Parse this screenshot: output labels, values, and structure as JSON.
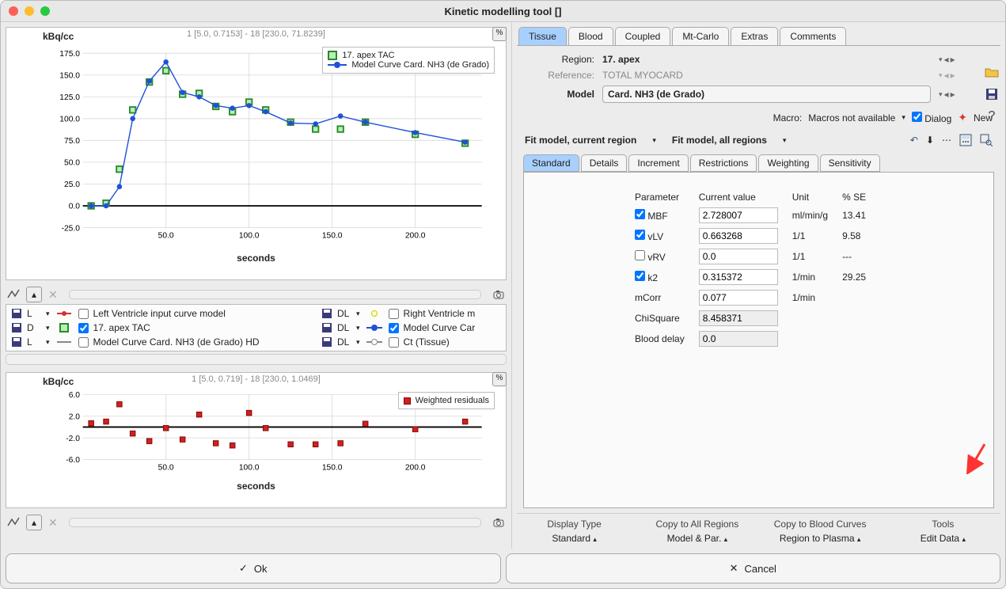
{
  "window": {
    "title": "Kinetic modelling tool []"
  },
  "chart_data": [
    {
      "type": "line+scatter",
      "ylabel": "kBq/cc",
      "xlabel": "seconds",
      "subtitle": "1 [5.0, 0.7153] - 18 [230.0, 71.8239]",
      "xlim": [
        0,
        240
      ],
      "ylim": [
        -25,
        175
      ],
      "xticks": [
        50,
        100,
        150,
        200
      ],
      "yticks": [
        -25,
        0,
        25,
        50,
        75,
        100,
        125,
        150,
        175
      ],
      "legend": [
        "17. apex TAC",
        "Model Curve Card. NH3 (de Grado)"
      ],
      "series": [
        {
          "name": "17. apex TAC",
          "style": "green-square",
          "x": [
            5,
            14,
            22,
            30,
            40,
            50,
            60,
            70,
            80,
            90,
            100,
            110,
            125,
            140,
            155,
            170,
            200,
            230
          ],
          "y": [
            0,
            3,
            42,
            110,
            142,
            155,
            128,
            129,
            114,
            108,
            119,
            110,
            96,
            88,
            88,
            96,
            82,
            71.8
          ]
        },
        {
          "name": "Model Curve Card. NH3 (de Grado)",
          "style": "blue-line-dot",
          "x": [
            5,
            14,
            22,
            30,
            40,
            50,
            60,
            70,
            80,
            90,
            100,
            110,
            125,
            140,
            155,
            170,
            200,
            230
          ],
          "y": [
            0,
            0,
            22,
            100,
            143,
            165,
            130,
            125,
            115,
            112,
            115,
            108,
            95,
            94,
            103,
            96,
            84,
            73
          ]
        }
      ]
    },
    {
      "type": "scatter",
      "ylabel": "kBq/cc",
      "xlabel": "seconds",
      "subtitle": "1 [5.0, 0.719] - 18 [230.0, 1.0469]",
      "xlim": [
        0,
        240
      ],
      "ylim": [
        -6,
        6
      ],
      "xticks": [
        50,
        100,
        150,
        200
      ],
      "yticks": [
        -6,
        -2,
        2,
        6
      ],
      "legend": [
        "Weighted residuals"
      ],
      "series": [
        {
          "name": "Weighted residuals",
          "style": "red-square",
          "x": [
            5,
            14,
            22,
            30,
            40,
            50,
            60,
            70,
            80,
            90,
            100,
            110,
            125,
            140,
            155,
            170,
            200,
            230
          ],
          "y": [
            0.7,
            1,
            4.2,
            -1.2,
            -2.6,
            -0.2,
            -2.3,
            2.3,
            -3.0,
            -3.4,
            2.6,
            -0.2,
            -3.2,
            -3.2,
            -3.0,
            0.6,
            -0.4,
            1.0
          ]
        }
      ]
    }
  ],
  "curve_list": {
    "left": [
      {
        "code": "L",
        "checked": false,
        "label": "Left Ventricle input curve model"
      },
      {
        "code": "D",
        "checked": true,
        "label": "17. apex TAC"
      },
      {
        "code": "L",
        "checked": false,
        "label": "Model Curve Card. NH3 (de Grado) HD"
      }
    ],
    "right": [
      {
        "code": "DL",
        "checked": false,
        "label": "Right Ventricle m"
      },
      {
        "code": "DL",
        "checked": true,
        "label": "Model Curve Car"
      },
      {
        "code": "DL",
        "checked": false,
        "label": "Ct (Tissue)"
      }
    ]
  },
  "tabs": {
    "items": [
      "Tissue",
      "Blood",
      "Coupled",
      "Mt-Carlo",
      "Extras",
      "Comments"
    ],
    "active": 0
  },
  "region_block": {
    "region_label": "Region:",
    "region_value": "17. apex",
    "reference_label": "Reference:",
    "reference_value": "TOTAL MYOCARD",
    "model_label": "Model",
    "model_value": "Card. NH3 (de Grado)"
  },
  "macro": {
    "label": "Macro:",
    "value": "Macros not available",
    "dialog_label": "Dialog",
    "new_label": "New"
  },
  "fit": {
    "current": "Fit model, current region",
    "all": "Fit model, all regions"
  },
  "subtabs": {
    "items": [
      "Standard",
      "Details",
      "Increment",
      "Restrictions",
      "Weighting",
      "Sensitivity"
    ],
    "active": 0
  },
  "param_headers": {
    "p": "Parameter",
    "v": "Current value",
    "u": "Unit",
    "se": "% SE"
  },
  "params": [
    {
      "check": true,
      "name": "MBF",
      "value": "2.728007",
      "unit": "ml/min/g",
      "se": "13.41"
    },
    {
      "check": true,
      "name": "vLV",
      "value": "0.663268",
      "unit": "1/1",
      "se": "9.58"
    },
    {
      "check": false,
      "name": "vRV",
      "value": "0.0",
      "unit": "1/1",
      "se": "---"
    },
    {
      "check": true,
      "name": "k2",
      "value": "0.315372",
      "unit": "1/min",
      "se": "29.25"
    },
    {
      "check": null,
      "name": "mCorr",
      "value": "0.077",
      "unit": "1/min",
      "se": ""
    },
    {
      "check": null,
      "name": "ChiSquare",
      "value": "8.458371",
      "unit": "",
      "se": "",
      "readonly": true
    },
    {
      "check": null,
      "name": "Blood delay",
      "value": "0.0",
      "unit": "",
      "se": "",
      "readonly": true
    }
  ],
  "bottom": {
    "c1h": "Display Type",
    "c1v": "Standard",
    "c2h": "Copy to All Regions",
    "c2v": "Model & Par.",
    "c3h": "Copy to Blood Curves",
    "c3v": "Region to Plasma",
    "c4h": "Tools",
    "c4v": "Edit Data"
  },
  "buttons": {
    "ok": "Ok",
    "cancel": "Cancel"
  },
  "glyphs": {
    "pct": "%",
    "down": "▾",
    "up": "▴",
    "left": "◂",
    "right": "▸",
    "x": "✕",
    "check": "✓"
  }
}
